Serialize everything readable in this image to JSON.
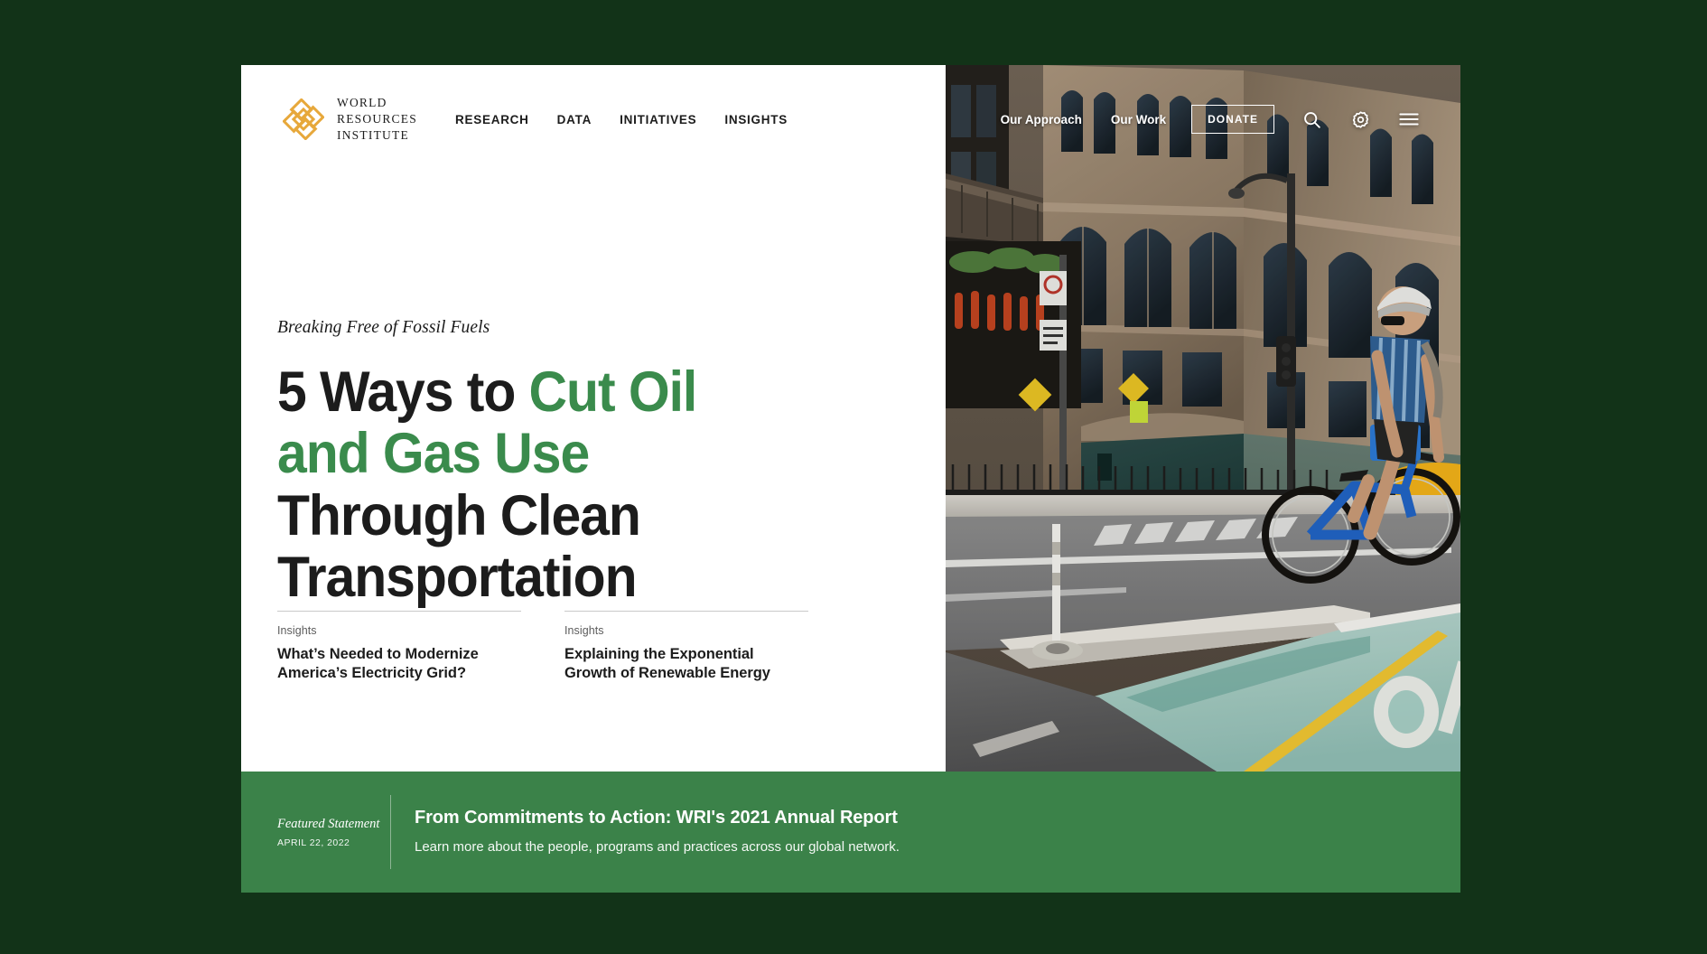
{
  "page": {
    "background_color": "#123318",
    "card_background": "#ffffff"
  },
  "header": {
    "brand": {
      "logo_icon": "wri-knot-logo-icon",
      "logo_color": "#e7a83b",
      "line1": "WORLD",
      "line2": "RESOURCES",
      "line3": "INSTITUTE"
    },
    "primary_nav": [
      {
        "label": "RESEARCH"
      },
      {
        "label": "DATA"
      },
      {
        "label": "INITIATIVES"
      },
      {
        "label": "INSIGHTS"
      }
    ],
    "secondary_nav": [
      {
        "label": "Our Approach"
      },
      {
        "label": "Our Work"
      }
    ],
    "donate_label": "DONATE",
    "icons": [
      {
        "name": "search-icon"
      },
      {
        "name": "gear-icon"
      },
      {
        "name": "hamburger-menu-icon"
      }
    ]
  },
  "hero": {
    "eyebrow": "Breaking Free of Fossil Fuels",
    "headline": {
      "part1": "5 Ways to ",
      "accent1": "Cut Oil and Gas Use",
      "part2": " Through Clean Transportation",
      "accent_color": "#3a8b4c",
      "text_color": "#1c1c1c"
    },
    "photo": {
      "alt": "Cyclist riding a blue bike-share bicycle in a green painted protected bike lane beside an ornate stone city building"
    }
  },
  "teasers": [
    {
      "kicker": "Insights",
      "title": "What’s Needed to Modernize America’s Electricity Grid?"
    },
    {
      "kicker": "Insights",
      "title": "Explaining the Exponential Growth of Renewable Energy"
    }
  ],
  "featured": {
    "label": "Featured Statement",
    "date": "APRIL 22, 2022",
    "title": "From Commitments to Action: WRI's 2021 Annual Report",
    "description": "Learn more about the people, programs and practices across our global network.",
    "background_color": "#3b8249"
  }
}
